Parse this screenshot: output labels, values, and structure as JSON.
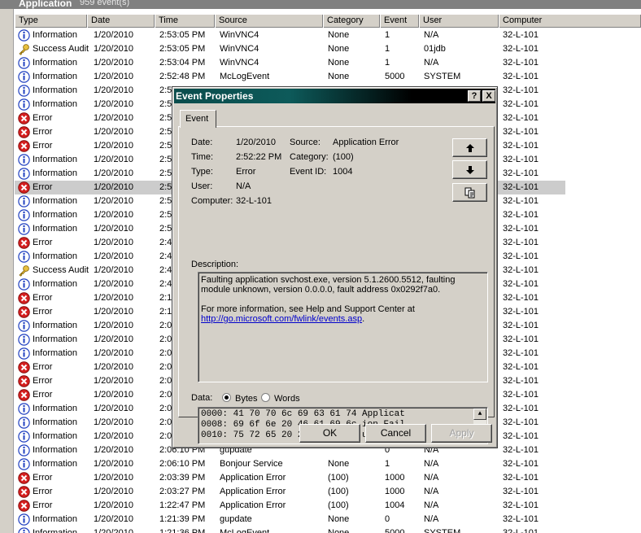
{
  "window": {
    "title": "Application",
    "count": "959 event(s)"
  },
  "columns": [
    "Type",
    "Date",
    "Time",
    "Source",
    "Category",
    "Event",
    "User",
    "Computer"
  ],
  "rows": [
    {
      "icon": "info",
      "type": "Information",
      "date": "1/20/2010",
      "time": "2:53:05 PM",
      "source": "WinVNC4",
      "category": "None",
      "event": "1",
      "user": "N/A",
      "computer": "32-L-101"
    },
    {
      "icon": "key",
      "type": "Success Audit",
      "date": "1/20/2010",
      "time": "2:53:05 PM",
      "source": "WinVNC4",
      "category": "None",
      "event": "1",
      "user": "01jdb",
      "computer": "32-L-101"
    },
    {
      "icon": "info",
      "type": "Information",
      "date": "1/20/2010",
      "time": "2:53:04 PM",
      "source": "WinVNC4",
      "category": "None",
      "event": "1",
      "user": "N/A",
      "computer": "32-L-101"
    },
    {
      "icon": "info",
      "type": "Information",
      "date": "1/20/2010",
      "time": "2:52:48 PM",
      "source": "McLogEvent",
      "category": "None",
      "event": "5000",
      "user": "SYSTEM",
      "computer": "32-L-101"
    },
    {
      "icon": "info",
      "type": "Information",
      "date": "1/20/2010",
      "time": "2:5",
      "source": "",
      "category": "",
      "event": "",
      "user": "",
      "computer": "32-L-101"
    },
    {
      "icon": "info",
      "type": "Information",
      "date": "1/20/2010",
      "time": "2:5",
      "source": "",
      "category": "",
      "event": "",
      "user": "",
      "computer": "32-L-101"
    },
    {
      "icon": "error",
      "type": "Error",
      "date": "1/20/2010",
      "time": "2:5",
      "source": "",
      "category": "",
      "event": "",
      "user": "",
      "computer": "32-L-101"
    },
    {
      "icon": "error",
      "type": "Error",
      "date": "1/20/2010",
      "time": "2:5",
      "source": "",
      "category": "",
      "event": "",
      "user": "",
      "computer": "32-L-101"
    },
    {
      "icon": "error",
      "type": "Error",
      "date": "1/20/2010",
      "time": "2:5",
      "source": "",
      "category": "",
      "event": "",
      "user": "",
      "computer": "32-L-101"
    },
    {
      "icon": "info",
      "type": "Information",
      "date": "1/20/2010",
      "time": "2:5",
      "source": "",
      "category": "",
      "event": "",
      "user": "",
      "computer": "32-L-101"
    },
    {
      "icon": "info",
      "type": "Information",
      "date": "1/20/2010",
      "time": "2:5",
      "source": "",
      "category": "",
      "event": "",
      "user": "",
      "computer": "32-L-101"
    },
    {
      "icon": "error",
      "type": "Error",
      "date": "1/20/2010",
      "time": "2:5",
      "source": "",
      "category": "",
      "event": "",
      "user": "",
      "computer": "32-L-101",
      "selected": true
    },
    {
      "icon": "info",
      "type": "Information",
      "date": "1/20/2010",
      "time": "2:5",
      "source": "",
      "category": "",
      "event": "",
      "user": "",
      "computer": "32-L-101"
    },
    {
      "icon": "info",
      "type": "Information",
      "date": "1/20/2010",
      "time": "2:5",
      "source": "",
      "category": "",
      "event": "",
      "user": "",
      "computer": "32-L-101"
    },
    {
      "icon": "info",
      "type": "Information",
      "date": "1/20/2010",
      "time": "2:5",
      "source": "",
      "category": "",
      "event": "",
      "user": "",
      "computer": "32-L-101"
    },
    {
      "icon": "error",
      "type": "Error",
      "date": "1/20/2010",
      "time": "2:4",
      "source": "",
      "category": "",
      "event": "",
      "user": "",
      "computer": "32-L-101"
    },
    {
      "icon": "info",
      "type": "Information",
      "date": "1/20/2010",
      "time": "2:4",
      "source": "",
      "category": "",
      "event": "",
      "user": "",
      "computer": "32-L-101"
    },
    {
      "icon": "key",
      "type": "Success Audit",
      "date": "1/20/2010",
      "time": "2:4",
      "source": "",
      "category": "",
      "event": "",
      "user": "",
      "computer": "32-L-101"
    },
    {
      "icon": "info",
      "type": "Information",
      "date": "1/20/2010",
      "time": "2:4",
      "source": "",
      "category": "",
      "event": "",
      "user": "",
      "computer": "32-L-101"
    },
    {
      "icon": "error",
      "type": "Error",
      "date": "1/20/2010",
      "time": "2:1",
      "source": "",
      "category": "",
      "event": "",
      "user": "",
      "computer": "32-L-101"
    },
    {
      "icon": "error",
      "type": "Error",
      "date": "1/20/2010",
      "time": "2:1",
      "source": "",
      "category": "",
      "event": "",
      "user": "",
      "computer": "32-L-101"
    },
    {
      "icon": "info",
      "type": "Information",
      "date": "1/20/2010",
      "time": "2:0",
      "source": "",
      "category": "",
      "event": "",
      "user": "",
      "computer": "32-L-101"
    },
    {
      "icon": "info",
      "type": "Information",
      "date": "1/20/2010",
      "time": "2:0",
      "source": "",
      "category": "",
      "event": "",
      "user": "",
      "computer": "32-L-101"
    },
    {
      "icon": "info",
      "type": "Information",
      "date": "1/20/2010",
      "time": "2:0",
      "source": "",
      "category": "",
      "event": "",
      "user": "",
      "computer": "32-L-101"
    },
    {
      "icon": "error",
      "type": "Error",
      "date": "1/20/2010",
      "time": "2:0",
      "source": "",
      "category": "",
      "event": "",
      "user": "",
      "computer": "32-L-101"
    },
    {
      "icon": "error",
      "type": "Error",
      "date": "1/20/2010",
      "time": "2:0",
      "source": "",
      "category": "",
      "event": "",
      "user": "",
      "computer": "32-L-101"
    },
    {
      "icon": "error",
      "type": "Error",
      "date": "1/20/2010",
      "time": "2:0",
      "source": "",
      "category": "",
      "event": "",
      "user": "",
      "computer": "32-L-101"
    },
    {
      "icon": "info",
      "type": "Information",
      "date": "1/20/2010",
      "time": "2:0",
      "source": "",
      "category": "",
      "event": "",
      "user": "",
      "computer": "32-L-101"
    },
    {
      "icon": "info",
      "type": "Information",
      "date": "1/20/2010",
      "time": "2:0",
      "source": "",
      "category": "",
      "event": "",
      "user": "",
      "computer": "32-L-101"
    },
    {
      "icon": "info",
      "type": "Information",
      "date": "1/20/2010",
      "time": "2:0",
      "source": "",
      "category": "",
      "event": "",
      "user": "",
      "computer": "32-L-101"
    },
    {
      "icon": "info",
      "type": "Information",
      "date": "1/20/2010",
      "time": "2:06:10 PM",
      "source": "gupdate",
      "category": "",
      "event": "0",
      "user": "N/A",
      "computer": "32-L-101"
    },
    {
      "icon": "info",
      "type": "Information",
      "date": "1/20/2010",
      "time": "2:06:10 PM",
      "source": "Bonjour Service",
      "category": "None",
      "event": "1",
      "user": "N/A",
      "computer": "32-L-101"
    },
    {
      "icon": "error",
      "type": "Error",
      "date": "1/20/2010",
      "time": "2:03:39 PM",
      "source": "Application Error",
      "category": "(100)",
      "event": "1000",
      "user": "N/A",
      "computer": "32-L-101"
    },
    {
      "icon": "error",
      "type": "Error",
      "date": "1/20/2010",
      "time": "2:03:27 PM",
      "source": "Application Error",
      "category": "(100)",
      "event": "1000",
      "user": "N/A",
      "computer": "32-L-101"
    },
    {
      "icon": "error",
      "type": "Error",
      "date": "1/20/2010",
      "time": "1:22:47 PM",
      "source": "Application Error",
      "category": "(100)",
      "event": "1004",
      "user": "N/A",
      "computer": "32-L-101"
    },
    {
      "icon": "info",
      "type": "Information",
      "date": "1/20/2010",
      "time": "1:21:39 PM",
      "source": "gupdate",
      "category": "None",
      "event": "0",
      "user": "N/A",
      "computer": "32-L-101"
    },
    {
      "icon": "info",
      "type": "Information",
      "date": "1/20/2010",
      "time": "1:21:36 PM",
      "source": "McLogEvent",
      "category": "None",
      "event": "5000",
      "user": "SYSTEM",
      "computer": "32-L-101"
    }
  ],
  "dialog": {
    "title": "Event Properties",
    "help": "?",
    "close": "X",
    "tab": "Event",
    "labels": {
      "date": "Date:",
      "time": "Time:",
      "type": "Type:",
      "user": "User:",
      "computer": "Computer:",
      "source": "Source:",
      "category": "Category:",
      "event_id": "Event ID:",
      "description": "Description:",
      "data": "Data:",
      "bytes": "Bytes",
      "words": "Words"
    },
    "values": {
      "date": "1/20/2010",
      "time": "2:52:22 PM",
      "type": "Error",
      "user": "N/A",
      "computer": "32-L-101",
      "source": "Application Error",
      "category": "(100)",
      "event_id": "1004"
    },
    "description_line1": "Faulting application svchost.exe, version 5.1.2600.5512, faulting module unknown, version 0.0.0.0, fault address 0x0292f7a0.",
    "description_line2": "For more information, see Help and Support Center at",
    "description_link": "http://go.microsoft.com/fwlink/events.asp",
    "description_end": ".",
    "hex_lines": [
      "0000: 41 70 70 6c 69 63 61 74   Applicat",
      "0008: 69 6f 6e 20 46 61 69 6c   ion Fail",
      "0010: 75 72 65 20 20 73 76 63   ure  svc"
    ],
    "buttons": {
      "ok": "OK",
      "cancel": "Cancel",
      "apply": "Apply"
    }
  }
}
